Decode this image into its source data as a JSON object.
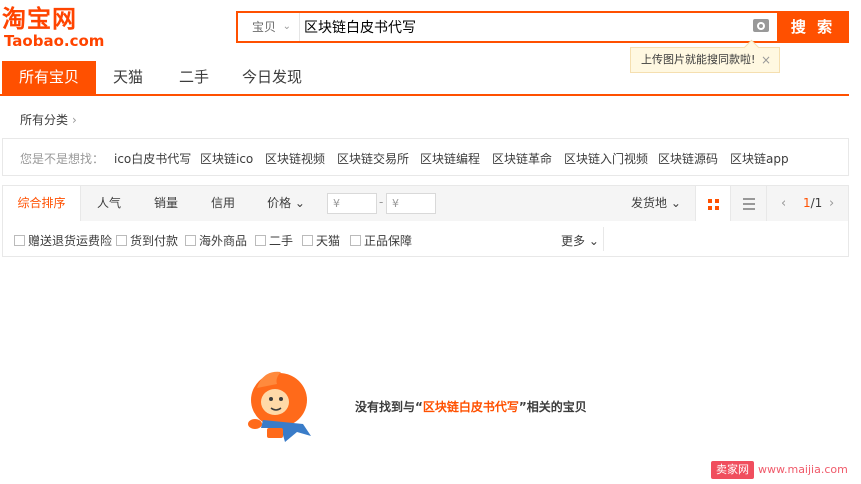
{
  "logo": {
    "cn": "淘宝网",
    "en": "Taobao.com"
  },
  "search": {
    "scope": "宝贝",
    "query": "区块链白皮书代写",
    "button": "搜 索",
    "camera_icon": "camera-icon",
    "tip": "上传图片就能搜同款啦!",
    "tip_close": "×"
  },
  "tabs": [
    "所有宝贝",
    "天猫",
    "二手",
    "今日发现"
  ],
  "categories": {
    "label": "所有分类",
    "arrow": "›"
  },
  "suggest": {
    "label": "您是不是想找：",
    "items": [
      "ico白皮书代写",
      "区块链ico",
      "区块链视频",
      "区块链交易所",
      "区块链编程",
      "区块链革命",
      "区块链入门视频",
      "区块链源码",
      "区块链app"
    ]
  },
  "sort": {
    "items": [
      "综合排序",
      "人气",
      "销量",
      "信用",
      "价格 ⌄"
    ],
    "price_min_placeholder": "¥",
    "price_max_placeholder": "¥",
    "dash": "-",
    "ship_from": "发货地 ⌄",
    "pager": {
      "prev": "‹",
      "next": "›",
      "current": "1",
      "total": "/1"
    }
  },
  "filters": [
    "赠送退货运费险",
    "货到付款",
    "海外商品",
    "二手",
    "天猫",
    "正品保障"
  ],
  "more": "更多 ⌄",
  "empty": {
    "before": "没有找到与“",
    "keyword": "区块链白皮书代写",
    "after": "”相关的宝贝"
  },
  "watermark": {
    "brand": "卖家网",
    "url": "www.maijia.com"
  },
  "colors": {
    "accent": "#ff5000",
    "text": "#3c3c3c",
    "muted": "#999999"
  }
}
